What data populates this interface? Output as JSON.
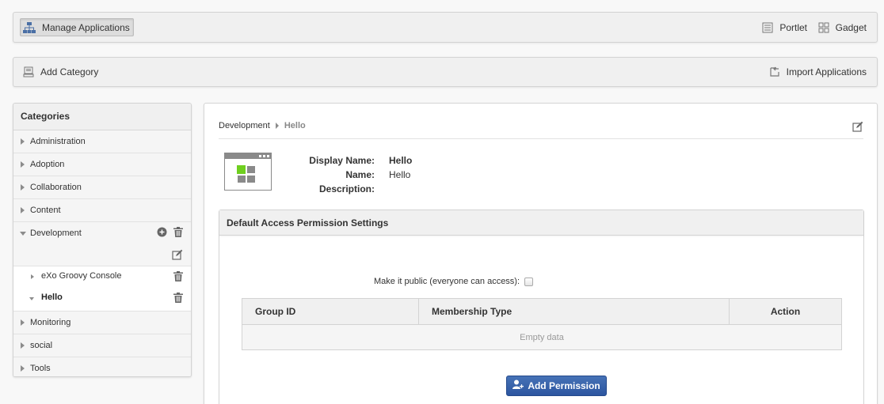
{
  "toolbar": {
    "manage_label": "Manage Applications",
    "portlet_label": "Portlet",
    "gadget_label": "Gadget"
  },
  "actionbar": {
    "add_category_label": "Add Category",
    "import_label": "Import Applications"
  },
  "sidebar": {
    "title": "Categories",
    "categories": [
      {
        "label": "Administration"
      },
      {
        "label": "Adoption"
      },
      {
        "label": "Collaboration"
      },
      {
        "label": "Content"
      },
      {
        "label": "Development",
        "expanded": true,
        "apps": [
          {
            "label": "eXo Groovy Console"
          },
          {
            "label": "Hello",
            "selected": true
          }
        ]
      },
      {
        "label": "Monitoring"
      },
      {
        "label": "social"
      },
      {
        "label": "Tools"
      }
    ]
  },
  "main": {
    "breadcrumb": {
      "parent": "Development",
      "current": "Hello"
    },
    "info": {
      "display_name_label": "Display Name:",
      "display_name": "Hello",
      "name_label": "Name:",
      "name": "Hello",
      "description_label": "Description:",
      "description": ""
    },
    "permissions": {
      "title": "Default Access Permission Settings",
      "public_label": "Make it public (everyone can access):",
      "public_checked": false,
      "columns": [
        "Group ID",
        "Membership Type",
        "Action"
      ],
      "empty_text": "Empty data",
      "add_label": "Add Permission"
    }
  },
  "colors": {
    "accent_button": "#3561a9",
    "panel_bg": "#f0f0f0",
    "app_icon_green": "#6fcf1f"
  }
}
